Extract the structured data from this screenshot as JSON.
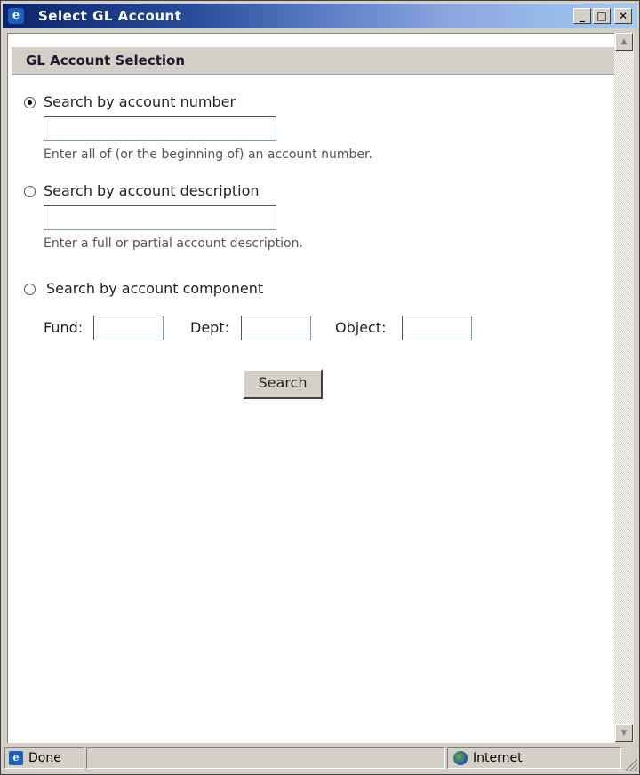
{
  "window": {
    "title": "Select GL Account",
    "minimize": "_",
    "maximize": "□",
    "close": "✕"
  },
  "page": {
    "heading": "GL Account Selection",
    "options": [
      {
        "label": "Search by account number",
        "selected": true,
        "hint": "Enter all of (or the beginning of) an account number.",
        "value": ""
      },
      {
        "label": "Search by account description",
        "selected": false,
        "hint": "Enter a full or partial account description.",
        "value": ""
      },
      {
        "label": "Search by account component",
        "selected": false
      }
    ],
    "components": {
      "fund_label": "Fund:",
      "dept_label": "Dept:",
      "object_label": "Object:",
      "fund_value": "",
      "dept_value": "",
      "object_value": ""
    },
    "search_button": "Search"
  },
  "statusbar": {
    "status": "Done",
    "zone": "Internet"
  },
  "icons": {
    "app": "ie-icon",
    "zone": "globe-icon"
  }
}
